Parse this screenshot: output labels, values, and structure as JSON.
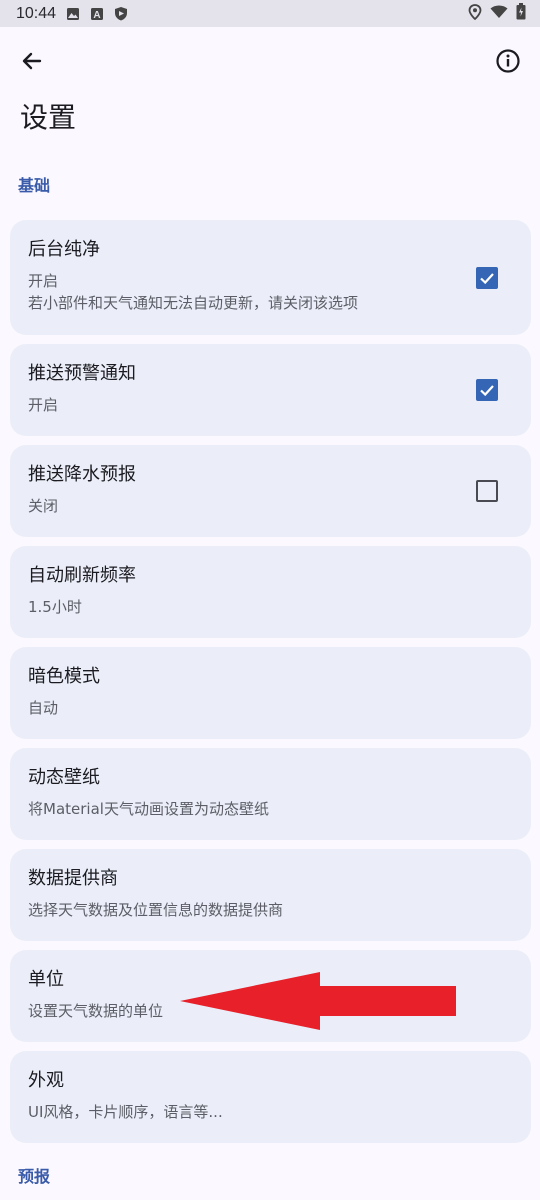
{
  "status_bar": {
    "time": "10:44",
    "icons_left": [
      "image-icon",
      "a-icon",
      "shield-icon"
    ],
    "icons_right": [
      "location-icon",
      "wifi-icon",
      "battery-icon"
    ]
  },
  "app_bar": {
    "title": "设置",
    "back_icon": "arrow-back-icon",
    "info_icon": "info-icon"
  },
  "sections": {
    "basic": "基础",
    "forecast": "预报"
  },
  "settings": [
    {
      "title": "后台纯净",
      "summary": "开启\n若小部件和天气通知无法自动更新，请关闭该选项",
      "checkbox": true
    },
    {
      "title": "推送预警通知",
      "summary": "开启",
      "checkbox": true
    },
    {
      "title": "推送降水预报",
      "summary": "关闭",
      "checkbox": false
    },
    {
      "title": "自动刷新频率",
      "summary": "1.5小时"
    },
    {
      "title": "暗色模式",
      "summary": "自动"
    },
    {
      "title": "动态壁纸",
      "summary": "将Material天气动画设置为动态壁纸"
    },
    {
      "title": "数据提供商",
      "summary": "选择天气数据及位置信息的数据提供商"
    },
    {
      "title": "单位",
      "summary": "设置天气数据的单位"
    },
    {
      "title": "外观",
      "summary": "UI风格，卡片顺序，语言等..."
    }
  ],
  "colors": {
    "accent": "#3565b5",
    "card_bg": "#ebeef8",
    "section_header": "#3a5ba9",
    "annotation_arrow": "#e8202a"
  },
  "annotation": {
    "type": "arrow",
    "direction": "left",
    "points_to": "单位"
  }
}
